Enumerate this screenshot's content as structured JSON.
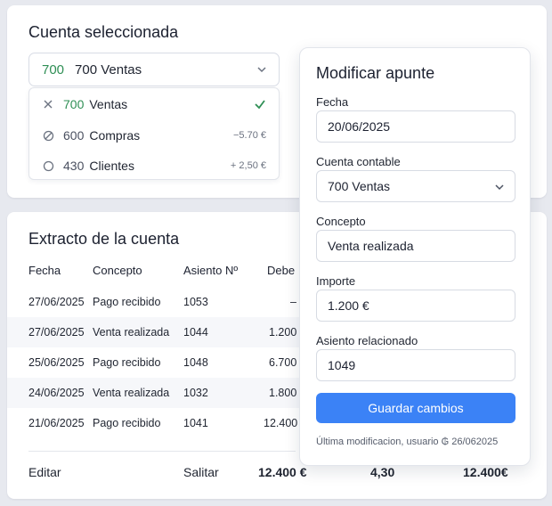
{
  "account_card": {
    "title": "Cuenta seleccionada",
    "selected": {
      "code": "700",
      "label": "700 Ventas"
    },
    "options": [
      {
        "icon": "close-icon",
        "code": "700",
        "name": "Ventas",
        "amount": "",
        "checked": true
      },
      {
        "icon": "blocked-icon",
        "code": "600",
        "name": "Compras",
        "amount": "−5.70 €",
        "checked": false
      },
      {
        "icon": "circle-icon",
        "code": "430",
        "name": "Clientes",
        "amount": "+ 2,50 €",
        "checked": false
      }
    ]
  },
  "statement": {
    "title": "Extracto de la cuenta",
    "columns": [
      "Fecha",
      "Concepto",
      "Asiento Nº",
      "Debe"
    ],
    "rows": [
      {
        "date": "27/06/2025",
        "concept": "Pago recibido",
        "entry": "1053",
        "debit": "–"
      },
      {
        "date": "27/06/2025",
        "concept": "Venta realizada",
        "entry": "1044",
        "debit": "1.200"
      },
      {
        "date": "25/06/2025",
        "concept": "Pago recibido",
        "entry": "1048",
        "debit": "6.700"
      },
      {
        "date": "24/06/2025",
        "concept": "Venta realizada",
        "entry": "1032",
        "debit": "1.800"
      },
      {
        "date": "21/06/2025",
        "concept": "Pago recibido",
        "entry": "1041",
        "debit": "12.400"
      }
    ],
    "footer": {
      "edit": "Editar",
      "split": "Salitar",
      "total_debit": "12.400 €",
      "total_mid": "4,30",
      "total_right": "12.400­€"
    }
  },
  "modal": {
    "title": "Modificar apunte",
    "date_label": "Fecha",
    "date_value": "20/06/2025",
    "account_label": "Cuenta contable",
    "account_value": "700 Ventas",
    "concept_label": "Concepto",
    "concept_value": "Venta realizada",
    "amount_label": "Importe",
    "amount_value": "1.200 €",
    "related_label": "Asiento relacionado",
    "related_value": "1049",
    "save_label": "Guardar cambios",
    "meta": "Última modificacion, usuario ₲ 26/062025"
  },
  "colors": {
    "accent": "#3b82f6",
    "green": "#2f8f55"
  }
}
